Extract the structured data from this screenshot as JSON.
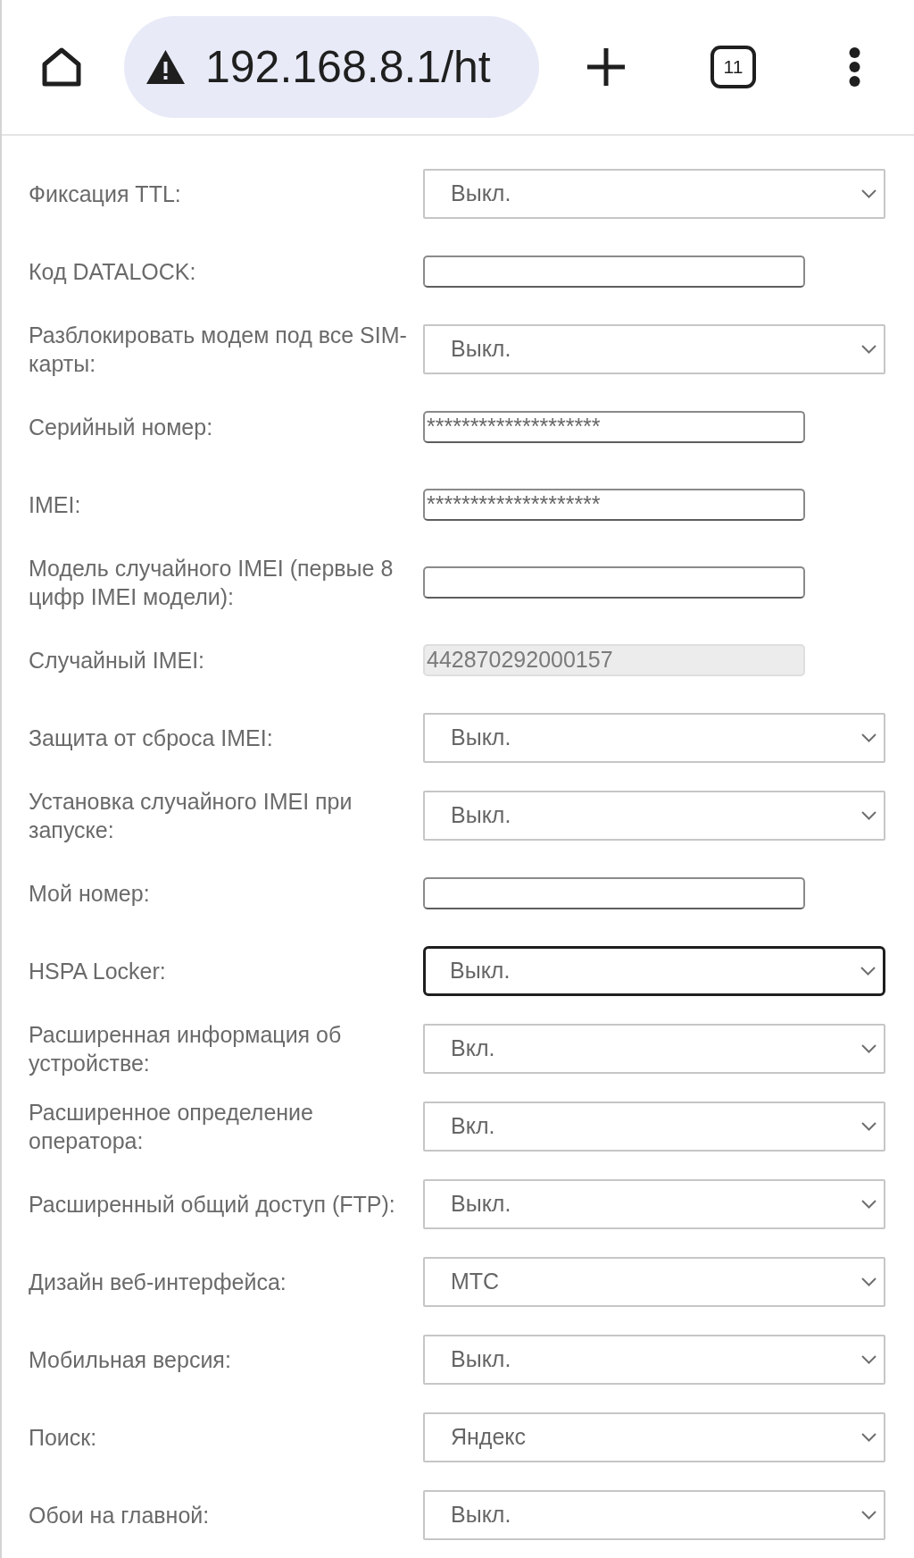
{
  "browser_toolbar": {
    "url": "192.168.8.1/ht",
    "tab_count": "11"
  },
  "settings": [
    {
      "label": "Фиксация TTL:",
      "kind": "select",
      "value": "Выкл.",
      "focused": false,
      "disabled": false
    },
    {
      "label": "Код DATALOCK:",
      "kind": "input",
      "focused": false,
      "disabled": false
    },
    {
      "label": "Разблокировать модем под все SIM-карты:",
      "kind": "select",
      "value": "Выкл.",
      "focused": false,
      "disabled": false
    },
    {
      "label": "Серийный номер:",
      "kind": "input",
      "value": "********************",
      "focused": false,
      "disabled": false
    },
    {
      "label": "IMEI:",
      "kind": "input",
      "value": "********************",
      "focused": false,
      "disabled": false
    },
    {
      "label": "Модель случайного IMEI (первые 8 цифр IMEI модели):",
      "kind": "input",
      "focused": false,
      "disabled": false
    },
    {
      "label": "Случайный IMEI:",
      "kind": "input",
      "value": "442870292000157",
      "focused": false,
      "disabled": true
    },
    {
      "label": "Защита от сброса IMEI:",
      "kind": "select",
      "value": "Выкл.",
      "focused": false,
      "disabled": false
    },
    {
      "label": "Установка случайного IMEI при запуске:",
      "kind": "select",
      "value": "Выкл.",
      "focused": false,
      "disabled": false
    },
    {
      "label": "Мой номер:",
      "kind": "input",
      "focused": false,
      "disabled": false
    },
    {
      "label": "HSPA Locker:",
      "kind": "select",
      "value": "Выкл.",
      "focused": true,
      "disabled": false
    },
    {
      "label": "Расширенная информация об устройстве:",
      "kind": "select",
      "value": "Вкл.",
      "focused": false,
      "disabled": false
    },
    {
      "label": "Расширенное определение оператора:",
      "kind": "select",
      "value": "Вкл.",
      "focused": false,
      "disabled": false
    },
    {
      "label": "Расширенный общий доступ (FTP):",
      "kind": "select",
      "value": "Выкл.",
      "focused": false,
      "disabled": false
    },
    {
      "label": "Дизайн веб-интерфейса:",
      "kind": "select",
      "value": "МТС",
      "focused": false,
      "disabled": false
    },
    {
      "label": "Мобильная версия:",
      "kind": "select",
      "value": "Выкл.",
      "focused": false,
      "disabled": false
    },
    {
      "label": "Поиск:",
      "kind": "select",
      "value": "Яндекс",
      "focused": false,
      "disabled": false
    },
    {
      "label": "Обои на главной:",
      "kind": "select",
      "value": "Выкл.",
      "focused": false,
      "disabled": false
    }
  ]
}
